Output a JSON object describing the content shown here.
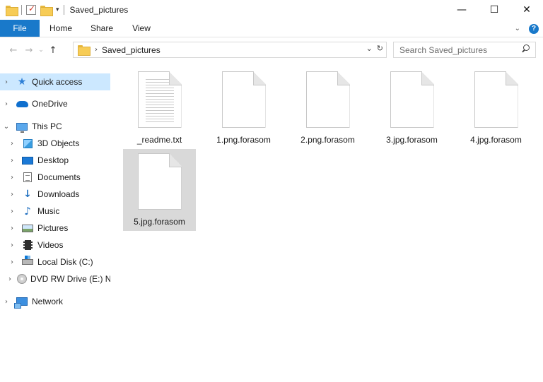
{
  "window": {
    "title": "Saved_pictures",
    "controls": {
      "minimize": "—",
      "maximize": "☐",
      "close": "✕"
    }
  },
  "quick_access_toolbar": {
    "icons": [
      "folder-icon",
      "properties-icon",
      "new-folder-icon",
      "customize-dropdown-icon"
    ],
    "dropdown_glyph": "▾"
  },
  "ribbon": {
    "tabs": [
      {
        "label": "File",
        "active": true
      },
      {
        "label": "Home"
      },
      {
        "label": "Share"
      },
      {
        "label": "View"
      }
    ],
    "expand_glyph": "⌄",
    "help_glyph": "?"
  },
  "address": {
    "back_glyph": "←",
    "forward_glyph": "→",
    "recent_glyph": "⌄",
    "up_glyph": "↑",
    "separator_glyph": "›",
    "path": "Saved_pictures",
    "dropdown_glyph": "⌄",
    "refresh_glyph": "↻"
  },
  "search": {
    "placeholder": "Search Saved_pictures"
  },
  "nav_pane": {
    "items": [
      {
        "label": "Quick access",
        "icon": "star-icon",
        "expander": "›",
        "selected": true
      },
      {
        "label": "OneDrive",
        "icon": "cloud-icon",
        "expander": "›"
      },
      {
        "label": "This PC",
        "icon": "computer-icon",
        "expander": "⌄"
      },
      {
        "label": "3D Objects",
        "icon": "3d-objects-icon",
        "expander": "›"
      },
      {
        "label": "Desktop",
        "icon": "desktop-icon",
        "expander": "›"
      },
      {
        "label": "Documents",
        "icon": "documents-icon",
        "expander": "›"
      },
      {
        "label": "Downloads",
        "icon": "downloads-icon",
        "expander": "›"
      },
      {
        "label": "Music",
        "icon": "music-icon",
        "expander": "›"
      },
      {
        "label": "Pictures",
        "icon": "pictures-icon",
        "expander": "›"
      },
      {
        "label": "Videos",
        "icon": "videos-icon",
        "expander": "›"
      },
      {
        "label": "Local Disk (C:)",
        "icon": "local-disk-icon",
        "expander": "›"
      },
      {
        "label": "DVD RW Drive (E:) N",
        "icon": "dvd-drive-icon",
        "expander": "›"
      },
      {
        "label": "Network",
        "icon": "network-icon",
        "expander": "›"
      }
    ]
  },
  "files": [
    {
      "name": "_readme.txt",
      "icon": "text-file-icon"
    },
    {
      "name": "1.png.forasom",
      "icon": "blank-file-icon"
    },
    {
      "name": "2.png.forasom",
      "icon": "blank-file-icon"
    },
    {
      "name": "3.jpg.forasom",
      "icon": "blank-file-icon"
    },
    {
      "name": "4.jpg.forasom",
      "icon": "blank-file-icon"
    },
    {
      "name": "5.jpg.forasom",
      "icon": "blank-file-icon",
      "selected": true
    }
  ],
  "colors": {
    "accent": "#1979ca",
    "nav_selected": "#cce8ff",
    "file_selected": "#d9d9d9",
    "folder": "#f7cc56"
  }
}
